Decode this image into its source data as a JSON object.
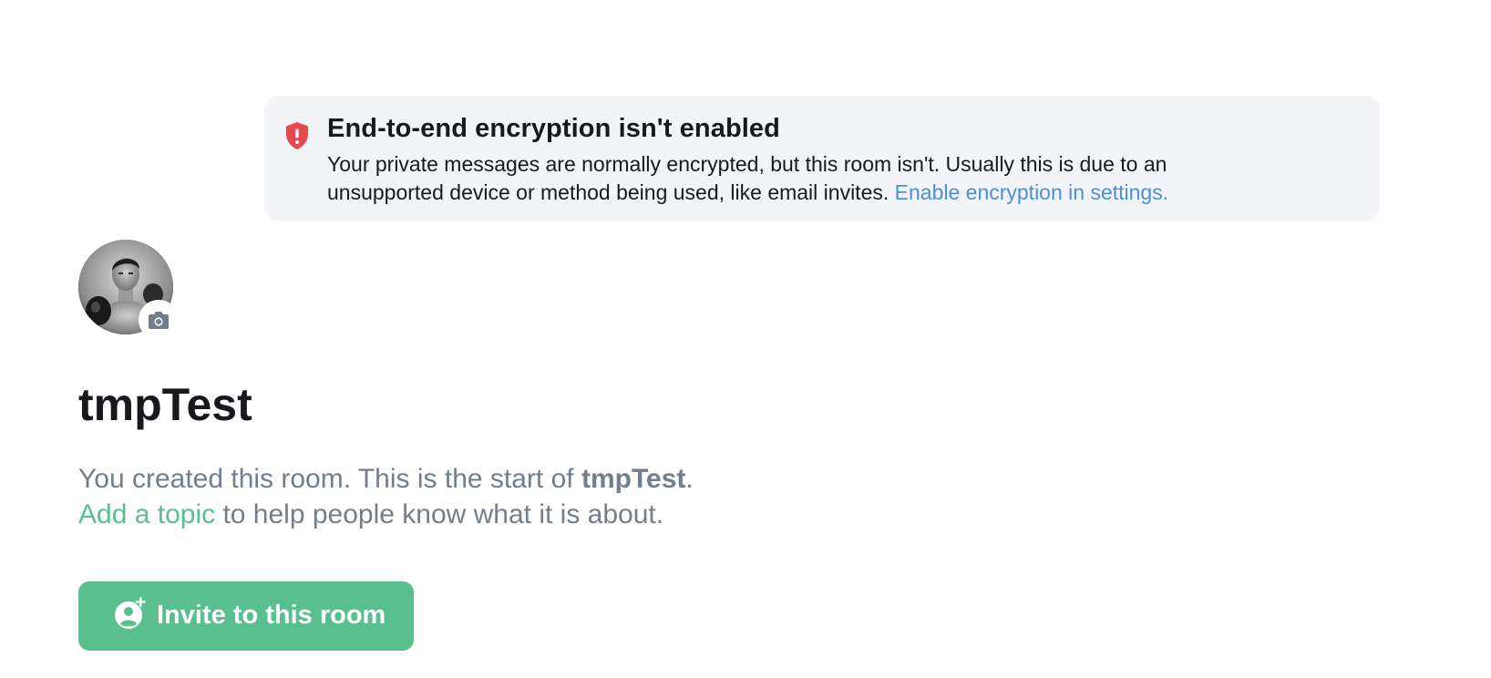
{
  "notice": {
    "icon": "shield-alert-icon",
    "title": "End-to-end encryption isn't enabled",
    "body_line1": "Your private messages are normally encrypted, but this room isn't. Usually this is due to an",
    "body_line2": "unsupported device or method being used, like email invites.",
    "link": "Enable encryption in settings.",
    "accent_color": "#e5484d",
    "link_color": "#4a8fd9"
  },
  "avatar": {
    "icon": "room-avatar-photo",
    "badge_icon": "camera-icon"
  },
  "room": {
    "name": "tmpTest"
  },
  "intro": {
    "line1_prefix": "You created this room. This is the start of",
    "line1_room": "tmpTest",
    "line1_suffix": ".",
    "topic_link": "Add a topic",
    "line2_suffix": " to help people know what it is about."
  },
  "invite_button": {
    "icon": "invite-user-icon",
    "label": "Invite to this room",
    "color": "#5abf8f"
  }
}
